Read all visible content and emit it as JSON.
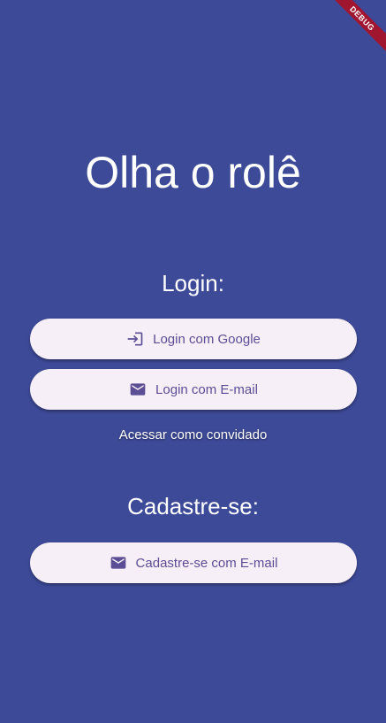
{
  "app": {
    "title": "Olha o rolê",
    "debug_banner": "DEBUG"
  },
  "login": {
    "heading": "Login:",
    "google_button": {
      "label": "Login com Google",
      "icon": "login-icon"
    },
    "email_button": {
      "label": "Login com E-mail",
      "icon": "mail-icon"
    },
    "guest_link": "Acessar como convidado"
  },
  "signup": {
    "heading": "Cadastre-se:",
    "email_button": {
      "label": "Cadastre-se com E-mail",
      "icon": "mail-icon"
    }
  },
  "colors": {
    "background": "#3d4a98",
    "button_bg": "#f6eff7",
    "button_text": "#5b4e94",
    "debug_ribbon": "#a01631"
  }
}
